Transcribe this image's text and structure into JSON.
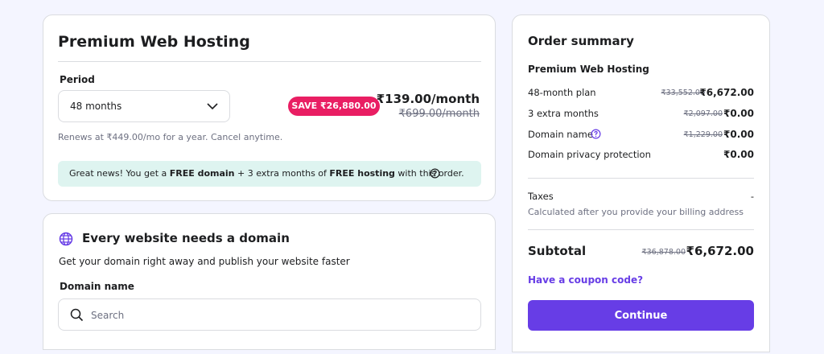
{
  "plan_card": {
    "title": "Premium Web Hosting",
    "period_label": "Period",
    "period_value": "48 months",
    "save_badge": "SAVE ₹26,880.00",
    "price": "₹139.00/month",
    "old_price": "₹699.00/month",
    "renewal_note": "Renews at ₹449.00/mo for a year. Cancel anytime.",
    "notice": {
      "part1": "Great news! You get a ",
      "bold1": "FREE domain",
      "part2": " + 3 extra months of ",
      "bold2": "FREE hosting",
      "part3": " with this order."
    }
  },
  "domain_card": {
    "title": "Every website needs a domain",
    "subtitle": "Get your domain right away and publish your website faster",
    "field_label": "Domain name",
    "search_placeholder": "Search"
  },
  "summary": {
    "title": "Order summary",
    "product": "Premium Web Hosting",
    "rows": [
      {
        "label": "48-month plan",
        "old": "₹33,552.00",
        "value": "₹6,672.00"
      },
      {
        "label": "3 extra months",
        "old": "₹2,097.00",
        "value": "₹0.00"
      },
      {
        "label": "Domain name",
        "old": "₹1,229.00",
        "value": "₹0.00"
      },
      {
        "label": "Domain privacy protection",
        "old": "",
        "value": "₹0.00"
      }
    ],
    "taxes_label": "Taxes",
    "taxes_value": "-",
    "taxes_note": "Calculated after you provide your billing address",
    "subtotal_label": "Subtotal",
    "subtotal_old": "₹36,878.00",
    "subtotal_value": "₹6,672.00",
    "coupon_link": "Have a coupon code?",
    "continue_label": "Continue"
  },
  "colors": {
    "accent": "#673de6",
    "save_badge": "#e91e63",
    "notice_bg": "#def4f0",
    "page_bg": "#f4f5ff"
  },
  "icons": [
    "chevron-down-icon",
    "help-circle-icon",
    "globe-icon",
    "search-icon"
  ]
}
